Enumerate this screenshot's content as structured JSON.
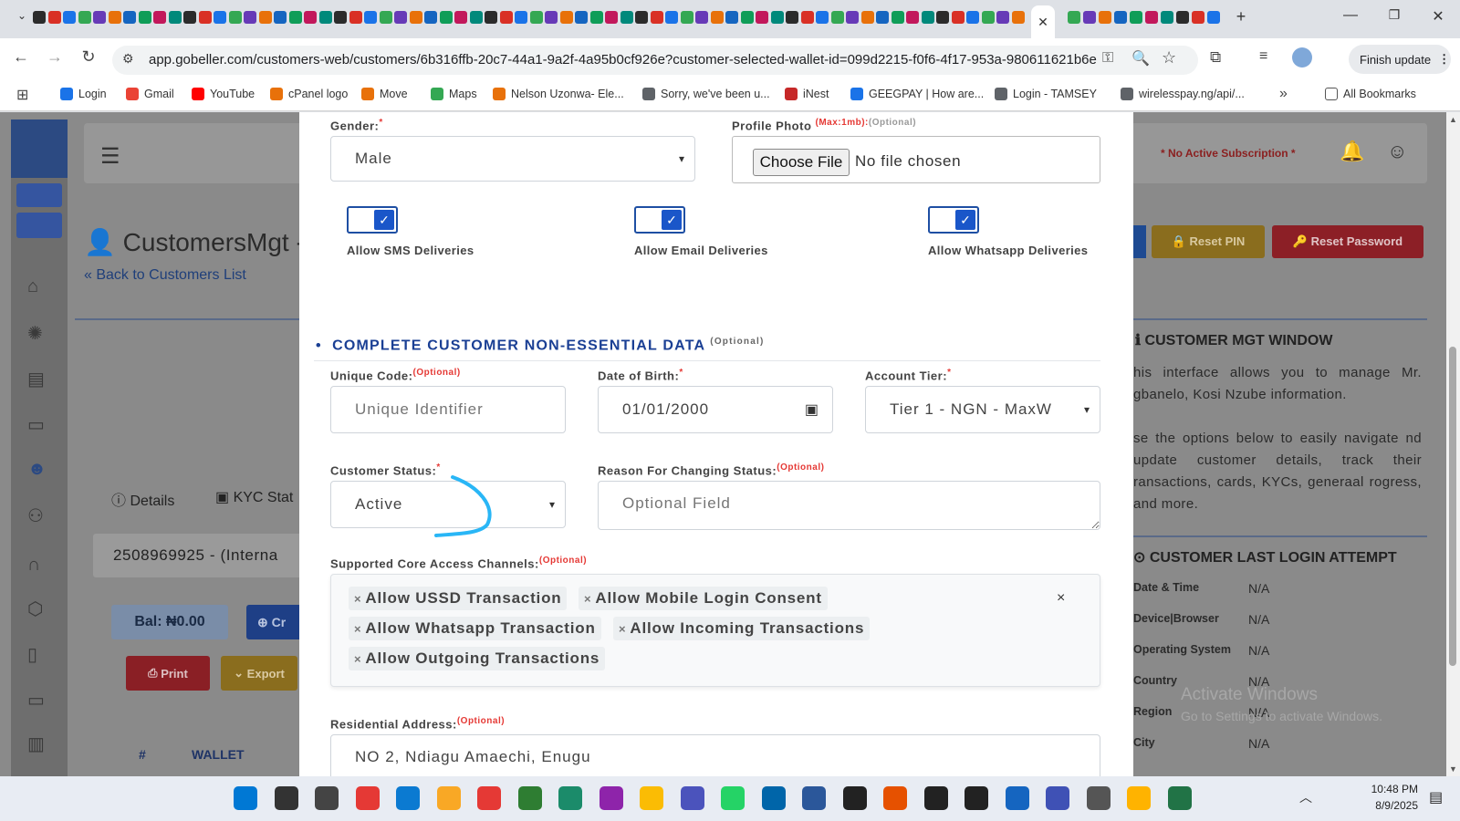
{
  "browser": {
    "active_tab_close": "✕",
    "url": "app.gobeller.com/customers-web/customers/6b316ffb-20c7-44a1-9a2f-4a95b0cf926e?customer-selected-wallet-id=099d2215-f0f6-4f17-953a-980611621b6e",
    "finish_update": "Finish update",
    "bookmarks": [
      "Login",
      "Gmail",
      "YouTube",
      "cPanel logo",
      "Move",
      "Maps",
      "Nelson Uzonwa- Ele...",
      "Sorry, we've been u...",
      "iNest",
      "GEEGPAY | How are...",
      "Login - TAMSEY",
      "wirelesspay.ng/api/..."
    ],
    "all_bookmarks": "All Bookmarks"
  },
  "background": {
    "no_subscription": "* No Active Subscription *",
    "page_title": "CustomersMgt -",
    "back_link": "« Back to Customers List",
    "reset_pin": "🔒 Reset PIN",
    "reset_password": "🔑 Reset Password",
    "tab_details": "Details",
    "tab_kyc": "KYC Stat",
    "wallet_select": "2508969925 - (Interna",
    "balance": "Bal: ₦0.00",
    "create_button": "Cr",
    "print_button": "Print",
    "export_button": "Export",
    "col_hash": "#",
    "col_wallet": "WALLET",
    "info_title": "CUSTOMER MGT WINDOW",
    "info_text1": "his interface allows you to manage Mr. gbanelo, Kosi Nzube information.",
    "info_text2": "se the options below to easily navigate nd update customer details, track their ransactions, cards, KYCs, generaal rogress, and more.",
    "login_title": "CUSTOMER LAST LOGIN ATTEMPT",
    "login_rows": [
      {
        "k": "Date & Time",
        "v": "N/A"
      },
      {
        "k": "Device|Browser",
        "v": "N/A"
      },
      {
        "k": "Operating System",
        "v": "N/A"
      },
      {
        "k": "Country",
        "v": "N/A"
      },
      {
        "k": "Region",
        "v": "N/A"
      },
      {
        "k": "City",
        "v": "N/A"
      }
    ],
    "watermark1": "Activate Windows",
    "watermark2": "Go to Settings to activate Windows."
  },
  "form": {
    "gender_label": "Gender:",
    "gender_value": "Male",
    "photo_label": "Profile Photo",
    "photo_max": "(Max:1mb):",
    "optional": "(Optional)",
    "choose_file": "Choose File",
    "no_file": "No file chosen",
    "allow_sms": "Allow SMS Deliveries",
    "allow_email": "Allow Email Deliveries",
    "allow_whatsapp": "Allow Whatsapp Deliveries",
    "section_title": "COMPLETE CUSTOMER NON-ESSENTIAL DATA",
    "unique_code_label": "Unique Code:",
    "unique_code_placeholder": "Unique Identifier",
    "dob_label": "Date of Birth:",
    "dob_value": "01/01/2000",
    "tier_label": "Account Tier:",
    "tier_value": "Tier 1 - NGN - MaxW",
    "status_label": "Customer Status:",
    "status_value": "Active",
    "reason_label": "Reason For Changing Status:",
    "reason_placeholder": "Optional Field",
    "channels_label": "Supported Core Access Channels:",
    "channels": [
      "Allow USSD Transaction",
      "Allow Mobile Login Consent",
      "Allow Whatsapp Transaction",
      "Allow Incoming Transactions",
      "Allow Outgoing Transactions"
    ],
    "address_label": "Residential Address:",
    "address_value": "NO 2, Ndiagu Amaechi, Enugu"
  },
  "taskbar": {
    "time": "10:48 PM",
    "date": "8/9/2025"
  }
}
